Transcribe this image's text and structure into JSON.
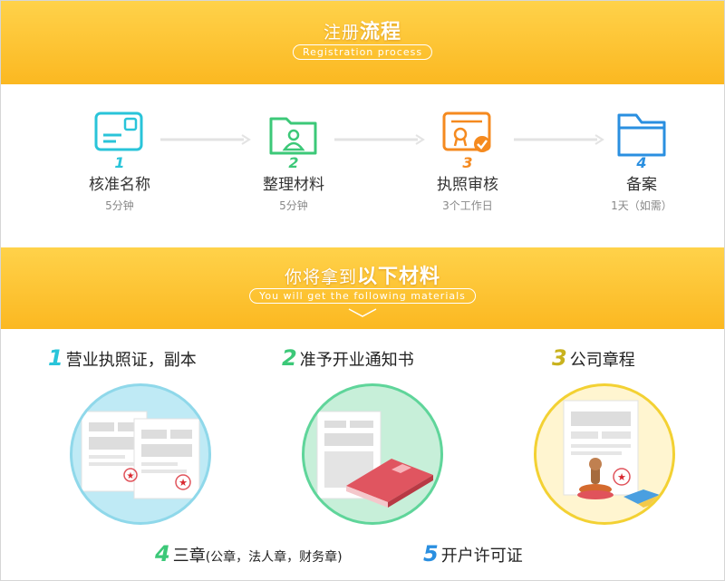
{
  "process": {
    "title_normal": "注册",
    "title_bold": "流程",
    "subtitle": "Registration process",
    "steps": [
      {
        "num": "1",
        "name": "核准名称",
        "time": "5分钟",
        "color": "#29c4d9"
      },
      {
        "num": "2",
        "name": "整理材料",
        "time": "5分钟",
        "color": "#3cc878"
      },
      {
        "num": "3",
        "name": "执照审核",
        "time": "3个工作日",
        "color": "#f58a1f"
      },
      {
        "num": "4",
        "name": "备案",
        "time": "1天（如需）",
        "color": "#2a8fe0"
      }
    ]
  },
  "materials": {
    "title_normal": "你将拿到",
    "title_bold": "以下材料",
    "subtitle": "You will get the following materials",
    "items": [
      {
        "num": "1",
        "label": "营业执照证，副本",
        "color": "#29c4d9"
      },
      {
        "num": "2",
        "label": "准予开业通知书",
        "color": "#3cc878"
      },
      {
        "num": "3",
        "label": "公司章程",
        "color": "#c9b21e"
      }
    ],
    "bottom": [
      {
        "num": "4",
        "label": "三章",
        "detail": "(公章，法人章，财务章)",
        "color": "#3cc878"
      },
      {
        "num": "5",
        "label": "开户许可证",
        "color": "#2a8fe0"
      }
    ]
  }
}
